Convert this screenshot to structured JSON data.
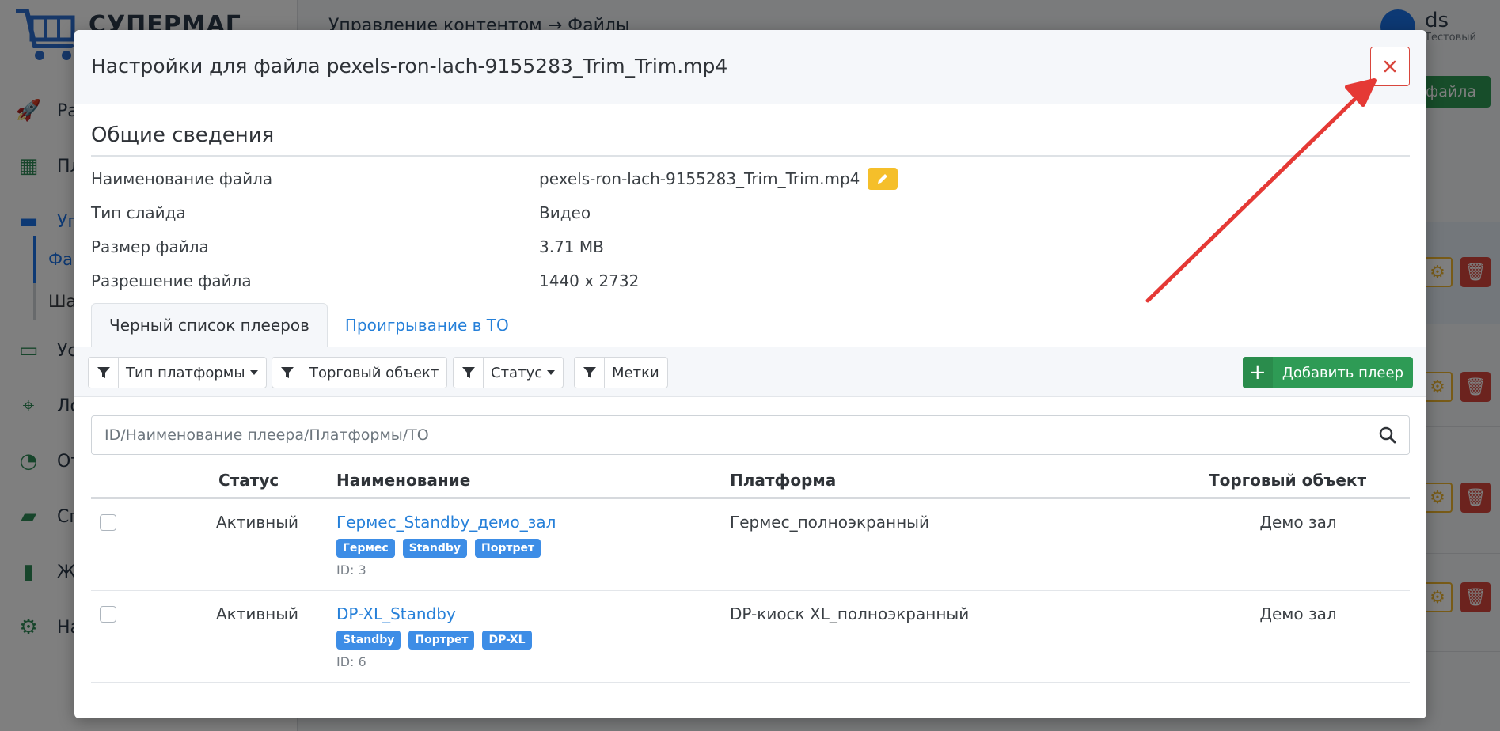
{
  "background": {
    "logo_text": "СУПЕРМАГ",
    "breadcrumb": "Управление контентом  →  Файлы",
    "user": {
      "name": "ds",
      "role": "Тестовый"
    },
    "add_file_label": "т файла",
    "nav": [
      {
        "label": "Рас",
        "icon": "rocket-icon"
      },
      {
        "label": "Пле",
        "icon": "images-icon"
      },
      {
        "label": "Упр",
        "icon": "drive-icon"
      },
      {
        "label": "Уст",
        "icon": "monitor-icon"
      },
      {
        "label": "Лок",
        "icon": "map-icon"
      },
      {
        "label": "Отч",
        "icon": "pie-chart-icon"
      },
      {
        "label": "Спр",
        "icon": "folder-icon"
      },
      {
        "label": "Жу",
        "icon": "book-icon"
      },
      {
        "label": "Нас",
        "icon": "gear-icon"
      }
    ],
    "sub_active": "Фай",
    "sub_other": "Ша"
  },
  "modal": {
    "title": "Настройки для файла pexels-ron-lach-9155283_Trim_Trim.mp4",
    "close_icon": "close-icon",
    "section_title": "Общие сведения",
    "info": [
      {
        "label": "Наименование файла",
        "value": "pexels-ron-lach-9155283_Trim_Trim.mp4"
      },
      {
        "label": "Тип слайда",
        "value": "Видео"
      },
      {
        "label": "Размер файла",
        "value": "3.71 MB"
      },
      {
        "label": "Разрешение файла",
        "value": "1440 x 2732"
      }
    ],
    "tabs": [
      {
        "label": "Черный список плееров",
        "active": true
      },
      {
        "label": "Проигрывание в ТО",
        "active": false
      }
    ],
    "filters": [
      {
        "label": "Тип платформы",
        "dropdown": true
      },
      {
        "label": "Торговый объект",
        "dropdown": false
      },
      {
        "label": "Статус",
        "dropdown": true
      },
      {
        "label": "Метки",
        "dropdown": false
      }
    ],
    "add_player_label": "Добавить плеер",
    "search_placeholder": "ID/Наименование плеера/Платформы/ТО",
    "table": {
      "headers": {
        "status": "Статус",
        "name": "Наименование",
        "platform": "Платформа",
        "to": "Торговый объект"
      },
      "rows": [
        {
          "status": "Активный",
          "name": "Гермес_Standby_демо_зал",
          "badges": [
            "Гермес",
            "Standby",
            "Портрет"
          ],
          "id": "ID: 3",
          "platform": "Гермес_полноэкранный",
          "to": "Демо зал"
        },
        {
          "status": "Активный",
          "name": "DP-XL_Standby",
          "badges": [
            "Standby",
            "Портрет",
            "DP-XL"
          ],
          "id": "ID: 6",
          "platform": "DP-киоск XL_полноэкранный",
          "to": "Демо зал"
        }
      ]
    }
  },
  "colors": {
    "accent_blue": "#2680d9",
    "success_green": "#2e9b55",
    "danger_red": "#d9463d",
    "warning_yellow": "#f5bf2a",
    "annotation_arrow": "#e53935"
  }
}
